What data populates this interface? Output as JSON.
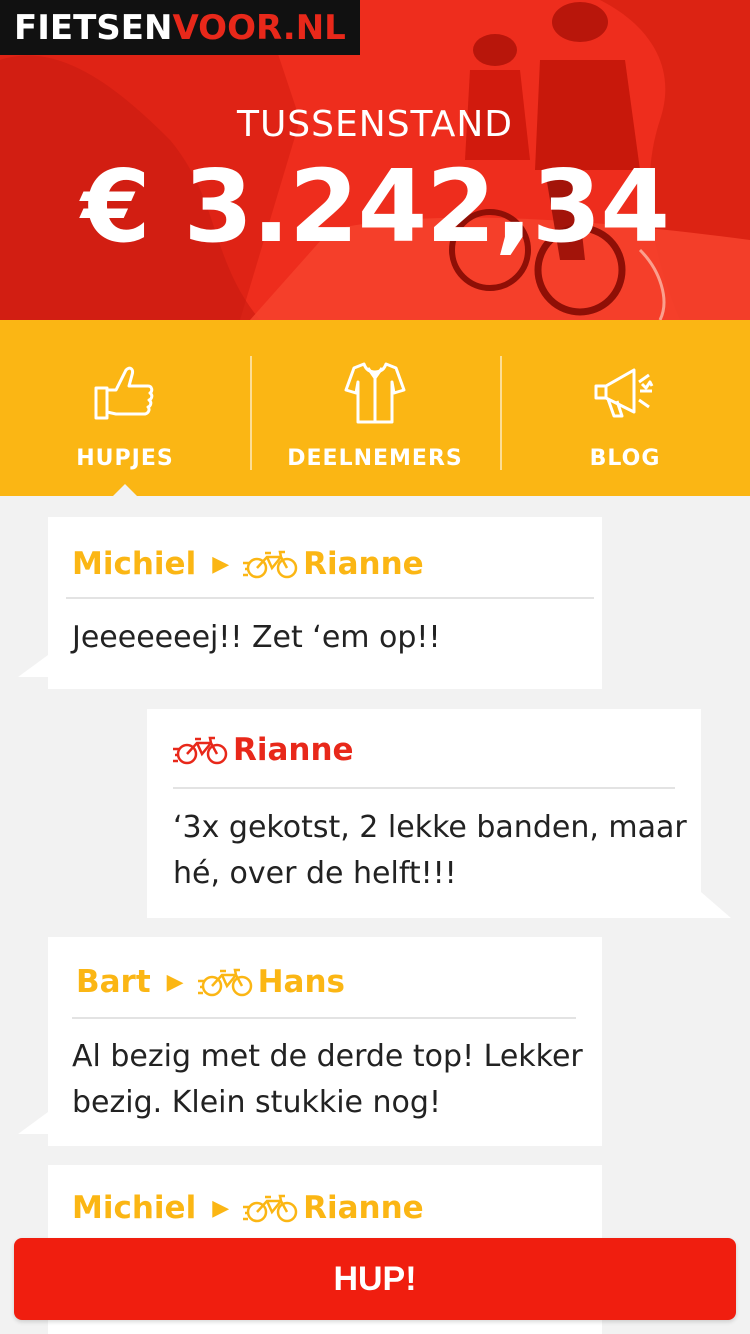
{
  "logo": {
    "part1": "FIETSEN",
    "part2": "VOOR.NL"
  },
  "hero": {
    "label": "TUSSENSTAND",
    "amount": "€ 3.242,34"
  },
  "tabs": [
    {
      "label": "HUPJES",
      "icon": "thumbs-up-icon",
      "active": true
    },
    {
      "label": "DEELNEMERS",
      "icon": "jersey-icon",
      "active": false
    },
    {
      "label": "BLOG",
      "icon": "megaphone-icon",
      "active": false
    }
  ],
  "messages": [
    {
      "from": "Michiel",
      "to": "Rianne",
      "text": "Jeeeeeeej!! Zet ‘em op!!",
      "side": "left"
    },
    {
      "from": "",
      "to": "Rianne",
      "text": "‘3x gekotst, 2 lekke banden, maar hé, over de helft!!!",
      "side": "right"
    },
    {
      "from": "Bart",
      "to": "Hans",
      "text": "Al bezig met de derde top! Lekker bezig. Klein stukkie nog!",
      "side": "left"
    },
    {
      "from": "Michiel",
      "to": "Rianne",
      "text": "",
      "side": "left"
    }
  ],
  "hup_button": {
    "label": "HUP!"
  },
  "colors": {
    "red": "#e8281a",
    "yellow": "#fbb614",
    "background": "#f2f2f2"
  },
  "icons": {
    "arrow": "▶",
    "bike": "bicycle-icon"
  }
}
